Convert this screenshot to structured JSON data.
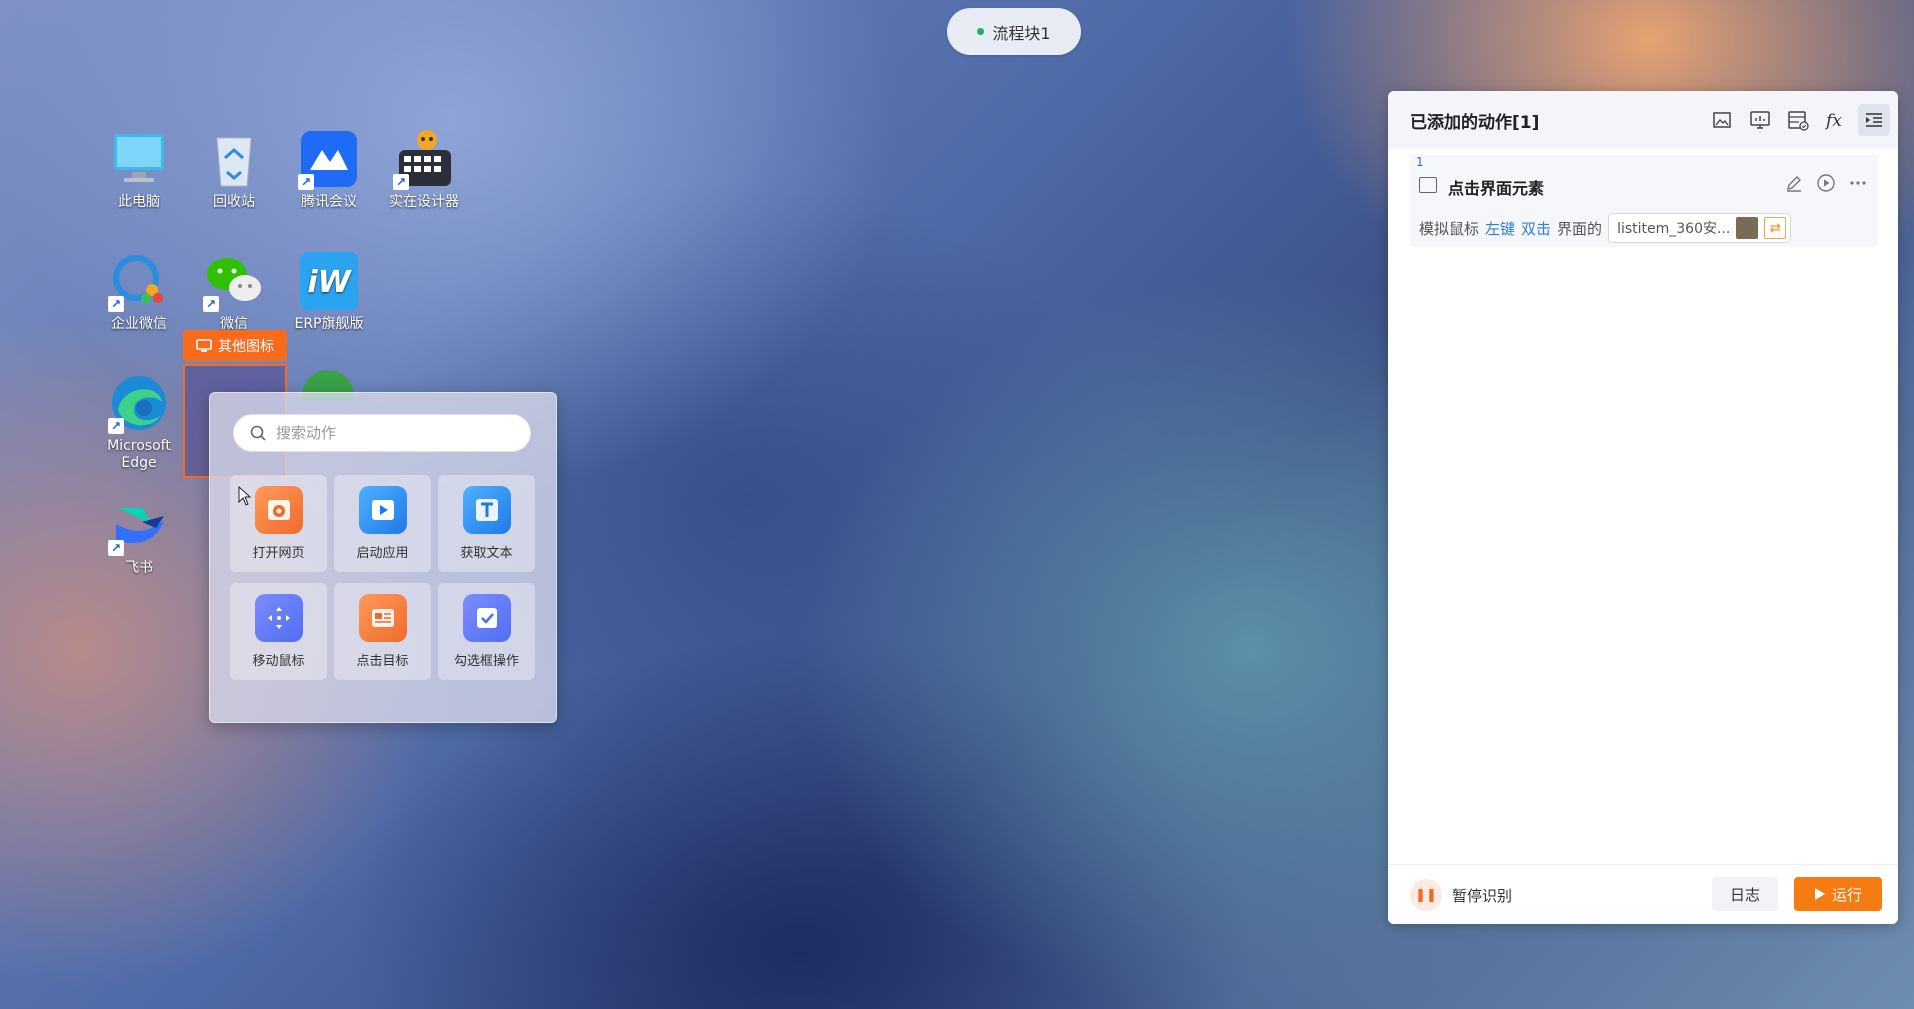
{
  "top_pill": {
    "label": "流程块1"
  },
  "desktop": {
    "icons": [
      {
        "label": "此电脑"
      },
      {
        "label": "回收站"
      },
      {
        "label": "腾讯会议"
      },
      {
        "label": "实在设计器"
      },
      {
        "label": "企业微信"
      },
      {
        "label": "微信"
      },
      {
        "label": "ERP旗舰版"
      },
      {
        "label": "Microsoft Edge"
      },
      {
        "label": "飞书"
      }
    ],
    "selection_label": "其他图标"
  },
  "action_popup": {
    "search_placeholder": "搜索动作",
    "tiles": [
      {
        "label": "打开网页",
        "color": "#f5803e"
      },
      {
        "label": "启动应用",
        "color": "#2489f0"
      },
      {
        "label": "获取文本",
        "color": "#2489f0"
      },
      {
        "label": "移动鼠标",
        "color": "#4f6ff0"
      },
      {
        "label": "点击目标",
        "color": "#f5803e"
      },
      {
        "label": "勾选框操作",
        "color": "#4f6ff0"
      }
    ]
  },
  "panel": {
    "title": "已添加的动作[1]",
    "actions": [
      {
        "index": "1",
        "title": "点击界面元素",
        "desc_prefix": "模拟鼠标",
        "button": "左键",
        "click_type": "双击",
        "desc_mid": "界面的",
        "target": "listitem_360安..."
      }
    ],
    "footer": {
      "pause_label": "暂停识别",
      "log_label": "日志",
      "run_label": "运行"
    },
    "colors": {
      "accent": "#f57b12",
      "link": "#2f7fd8"
    }
  }
}
